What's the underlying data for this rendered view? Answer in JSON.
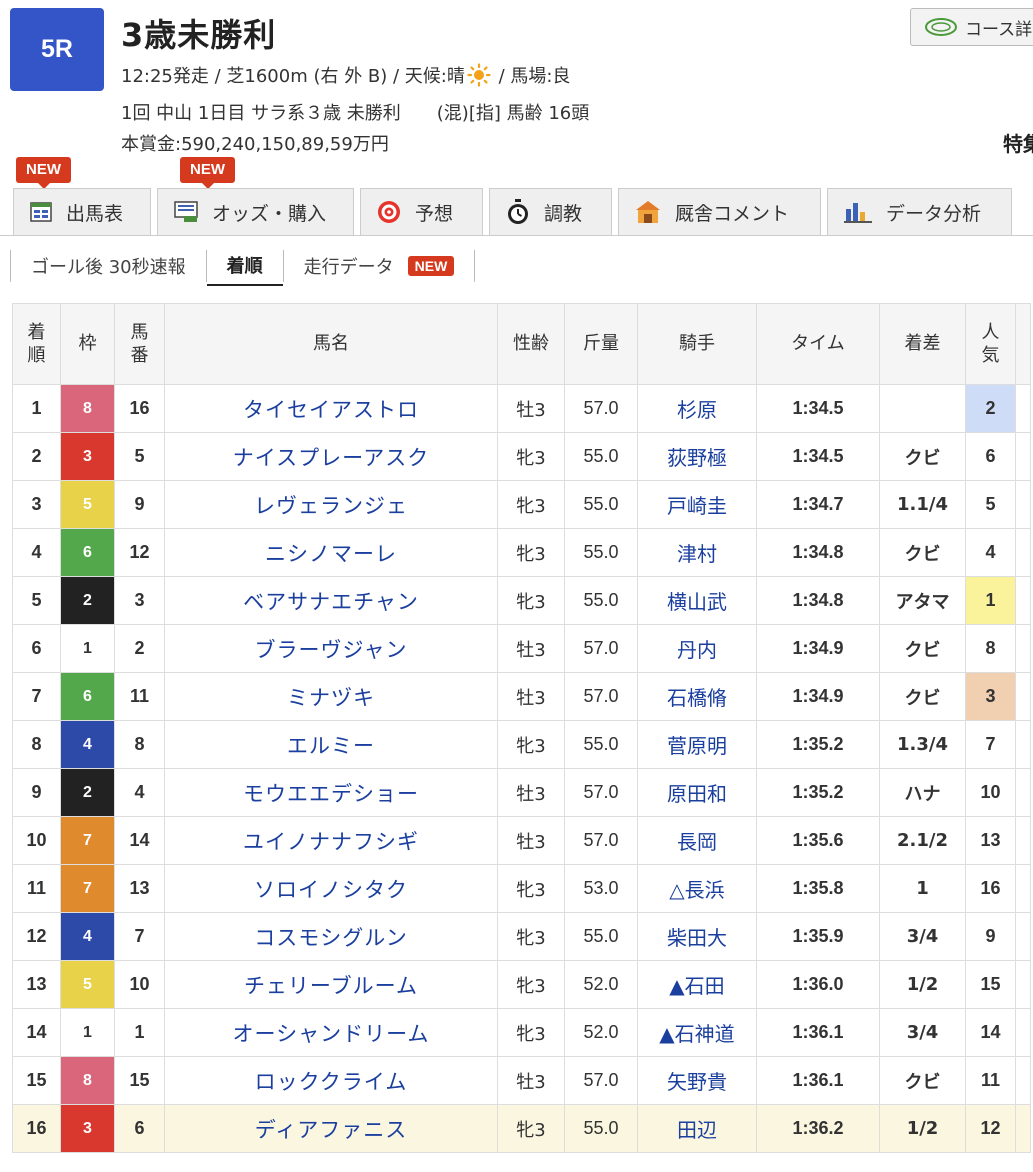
{
  "race": {
    "number": "5R",
    "title": "3歳未勝利",
    "start_info": "12:25発走 / 芝1600m (右 外 B) / 天候:晴",
    "ground_info": " / 馬場:良",
    "details": "1回 中山 1日目 サラ系３歳 未勝利　　(混)[指] 馬齢 16頭",
    "prize": "本賞金:590,240,150,89,59万円"
  },
  "course_button": "コース詳",
  "special_text": "特集",
  "badge_new": "NEW",
  "tabs": [
    {
      "label": "出馬表",
      "icon": "table-icon"
    },
    {
      "label": "オッズ・購入",
      "icon": "ipat-icon"
    },
    {
      "label": "予想",
      "icon": "target-icon"
    },
    {
      "label": "調教",
      "icon": "stopwatch-icon"
    },
    {
      "label": "厩舎コメント",
      "icon": "stable-icon"
    },
    {
      "label": "データ分析",
      "icon": "bar-chart-icon"
    }
  ],
  "subnav": [
    {
      "label": "ゴール後 30秒速報"
    },
    {
      "label": "着順"
    },
    {
      "label": "走行データ"
    }
  ],
  "table": {
    "headers": {
      "rank": "着順",
      "waku": "枠",
      "umaban": "馬番",
      "name": "馬名",
      "sexage": "性齢",
      "weight": "斤量",
      "jockey": "騎手",
      "time": "タイム",
      "margin": "着差",
      "pop": "人気"
    },
    "rows": [
      {
        "rank": "1",
        "waku": "8",
        "umaban": "16",
        "name": "タイセイアストロ",
        "sexage": "牡3",
        "weight": "57.0",
        "jockey": "杉原",
        "time": "1:34.5",
        "margin": "",
        "pop": "2"
      },
      {
        "rank": "2",
        "waku": "3",
        "umaban": "5",
        "name": "ナイスプレーアスク",
        "sexage": "牝3",
        "weight": "55.0",
        "jockey": "荻野極",
        "time": "1:34.5",
        "margin": "クビ",
        "pop": "6"
      },
      {
        "rank": "3",
        "waku": "5",
        "umaban": "9",
        "name": "レヴェランジェ",
        "sexage": "牝3",
        "weight": "55.0",
        "jockey": "戸崎圭",
        "time": "1:34.7",
        "margin": "1.1/4",
        "pop": "5"
      },
      {
        "rank": "4",
        "waku": "6",
        "umaban": "12",
        "name": "ニシノマーレ",
        "sexage": "牝3",
        "weight": "55.0",
        "jockey": "津村",
        "time": "1:34.8",
        "margin": "クビ",
        "pop": "4"
      },
      {
        "rank": "5",
        "waku": "2",
        "umaban": "3",
        "name": "ベアサナエチャン",
        "sexage": "牝3",
        "weight": "55.0",
        "jockey": "横山武",
        "time": "1:34.8",
        "margin": "アタマ",
        "pop": "1"
      },
      {
        "rank": "6",
        "waku": "1",
        "umaban": "2",
        "name": "ブラーヴジャン",
        "sexage": "牡3",
        "weight": "57.0",
        "jockey": "丹内",
        "time": "1:34.9",
        "margin": "クビ",
        "pop": "8"
      },
      {
        "rank": "7",
        "waku": "6",
        "umaban": "11",
        "name": "ミナヅキ",
        "sexage": "牡3",
        "weight": "57.0",
        "jockey": "石橋脩",
        "time": "1:34.9",
        "margin": "クビ",
        "pop": "3"
      },
      {
        "rank": "8",
        "waku": "4",
        "umaban": "8",
        "name": "エルミー",
        "sexage": "牝3",
        "weight": "55.0",
        "jockey": "菅原明",
        "time": "1:35.2",
        "margin": "1.3/4",
        "pop": "7"
      },
      {
        "rank": "9",
        "waku": "2",
        "umaban": "4",
        "name": "モウエエデショー",
        "sexage": "牡3",
        "weight": "57.0",
        "jockey": "原田和",
        "time": "1:35.2",
        "margin": "ハナ",
        "pop": "10"
      },
      {
        "rank": "10",
        "waku": "7",
        "umaban": "14",
        "name": "ユイノナナフシギ",
        "sexage": "牡3",
        "weight": "57.0",
        "jockey": "長岡",
        "time": "1:35.6",
        "margin": "2.1/2",
        "pop": "13"
      },
      {
        "rank": "11",
        "waku": "7",
        "umaban": "13",
        "name": "ソロイノシタク",
        "sexage": "牝3",
        "weight": "53.0",
        "jockey": "△長浜",
        "time": "1:35.8",
        "margin": "1",
        "pop": "16"
      },
      {
        "rank": "12",
        "waku": "4",
        "umaban": "7",
        "name": "コスモシグルン",
        "sexage": "牝3",
        "weight": "55.0",
        "jockey": "柴田大",
        "time": "1:35.9",
        "margin": "3/4",
        "pop": "9"
      },
      {
        "rank": "13",
        "waku": "5",
        "umaban": "10",
        "name": "チェリーブルーム",
        "sexage": "牝3",
        "weight": "52.0",
        "jockey": "▲石田",
        "time": "1:36.0",
        "margin": "1/2",
        "pop": "15"
      },
      {
        "rank": "14",
        "waku": "1",
        "umaban": "1",
        "name": "オーシャンドリーム",
        "sexage": "牝3",
        "weight": "52.0",
        "jockey": "▲石神道",
        "time": "1:36.1",
        "margin": "3/4",
        "pop": "14"
      },
      {
        "rank": "15",
        "waku": "8",
        "umaban": "15",
        "name": "ロッククライム",
        "sexage": "牡3",
        "weight": "57.0",
        "jockey": "矢野貴",
        "time": "1:36.1",
        "margin": "クビ",
        "pop": "11"
      },
      {
        "rank": "16",
        "waku": "3",
        "umaban": "6",
        "name": "ディアファニス",
        "sexage": "牝3",
        "weight": "55.0",
        "jockey": "田辺",
        "time": "1:36.2",
        "margin": "1/2",
        "pop": "12"
      }
    ]
  },
  "colors": {
    "race_badge": "#3355c8",
    "link": "#1a3f9e",
    "new_badge": "#d63a1e",
    "waku": {
      "1": {
        "bg": "#ffffff",
        "fg": "#333333"
      },
      "2": {
        "bg": "#222222",
        "fg": "#ffffff"
      },
      "3": {
        "bg": "#d9382e",
        "fg": "#ffffff"
      },
      "4": {
        "bg": "#2d4aa8",
        "fg": "#ffffff"
      },
      "5": {
        "bg": "#e8d24a",
        "fg": "#ffffff"
      },
      "6": {
        "bg": "#54a84c",
        "fg": "#ffffff"
      },
      "7": {
        "bg": "#e08a2e",
        "fg": "#ffffff"
      },
      "8": {
        "bg": "#d9667a",
        "fg": "#ffffff"
      }
    },
    "popularity_highlight": {
      "1": "#fbf29c",
      "2": "#cfdcf8",
      "3": "#f1cfb1"
    }
  }
}
